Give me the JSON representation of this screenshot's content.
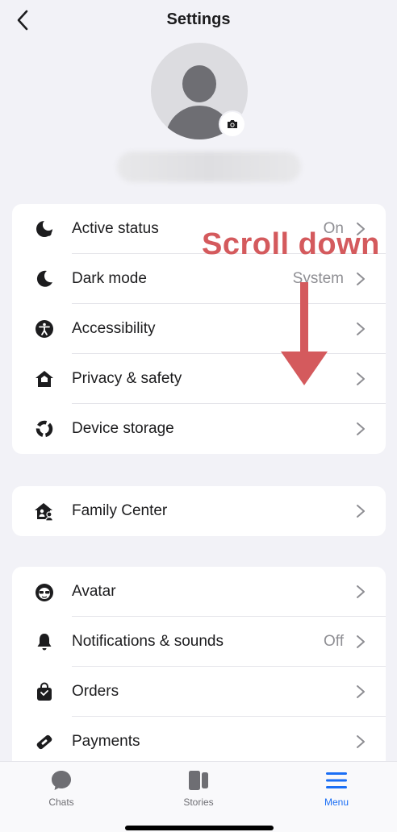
{
  "header": {
    "title": "Settings"
  },
  "scroll_hint": {
    "text": "Scroll down"
  },
  "groups": [
    {
      "rows": [
        {
          "label": "Active status",
          "value": "On",
          "icon": "active-status-icon"
        },
        {
          "label": "Dark mode",
          "value": "System",
          "icon": "moon-icon"
        },
        {
          "label": "Accessibility",
          "value": "",
          "icon": "accessibility-icon"
        },
        {
          "label": "Privacy & safety",
          "value": "",
          "icon": "privacy-home-icon"
        },
        {
          "label": "Device storage",
          "value": "",
          "icon": "storage-icon"
        }
      ]
    },
    {
      "rows": [
        {
          "label": "Family Center",
          "value": "",
          "icon": "family-home-icon"
        }
      ]
    },
    {
      "rows": [
        {
          "label": "Avatar",
          "value": "",
          "icon": "avatar-face-icon"
        },
        {
          "label": "Notifications & sounds",
          "value": "Off",
          "icon": "bell-icon"
        },
        {
          "label": "Orders",
          "value": "",
          "icon": "shopping-bag-icon"
        },
        {
          "label": "Payments",
          "value": "",
          "icon": "tag-icon"
        }
      ]
    }
  ],
  "tabbar": {
    "tabs": [
      {
        "label": "Chats",
        "icon": "chat-bubble-icon",
        "active": false
      },
      {
        "label": "Stories",
        "icon": "stories-icon",
        "active": false
      },
      {
        "label": "Menu",
        "icon": "menu-icon",
        "active": true
      }
    ]
  },
  "colors": {
    "accent": "#1a6ef5",
    "hint": "#d45a5d",
    "background": "#f2f2f7"
  }
}
